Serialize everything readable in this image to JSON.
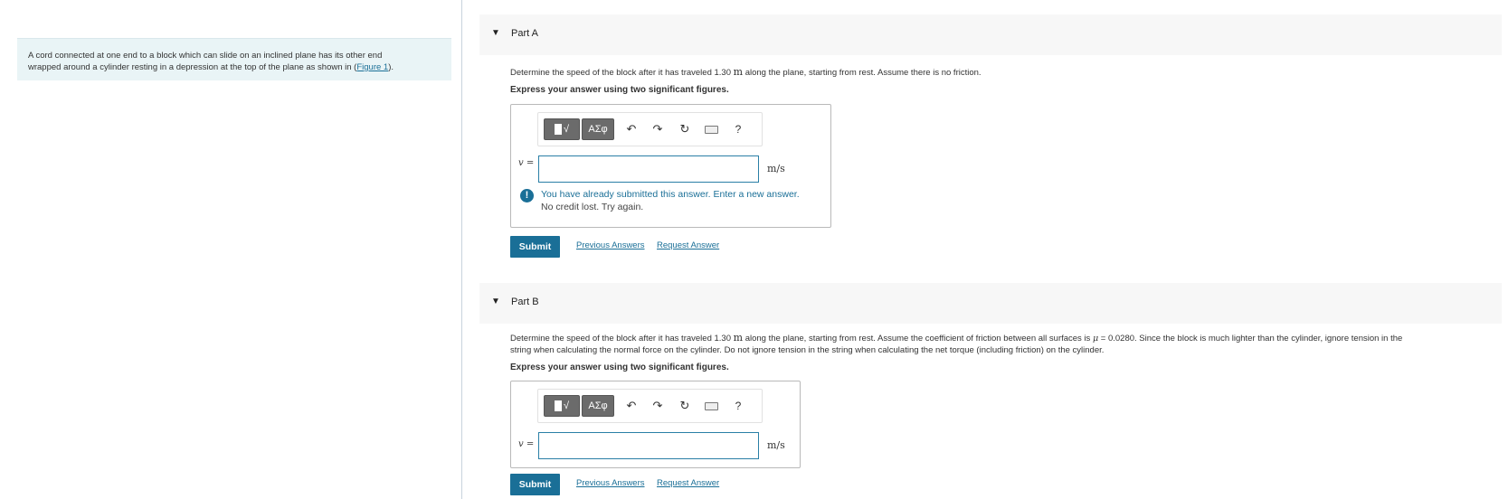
{
  "intro": {
    "line1": "A cord connected at one end to a block which can slide on an inclined plane has its other end",
    "line2_prefix": "wrapped around a cylinder resting in a depression at the top of the plane as shown in (",
    "figure_link": "Figure 1",
    "line2_suffix": ")."
  },
  "parts": [
    {
      "title": "Part A",
      "question_prefix": "Determine the speed of the block after it has traveled 1.30",
      "question_unit": "m",
      "question_suffix": "along the plane, starting from rest. Assume there is no friction.",
      "instruction": "Express your answer using two significant figures.",
      "toolbar": {
        "template_btn": "√",
        "symbols_btn": "ΑΣφ",
        "undo": "↶",
        "redo": "↷",
        "reset": "↻",
        "help": "?"
      },
      "variable": "v =",
      "input_value": "",
      "unit": "m/s",
      "feedback_icon": "!",
      "feedback_main": "You have already submitted this answer. Enter a new answer.",
      "feedback_sub": "No credit lost. Try again.",
      "submit": "Submit",
      "previous_answers": "Previous Answers",
      "request_answer": "Request Answer"
    },
    {
      "title": "Part B",
      "question_line1_prefix": "Determine the speed of the block after it has traveled 1.30",
      "question_unit": "m",
      "question_line1_mid": "along the plane, starting from rest. Assume the coefficient of friction between all surfaces is",
      "mu_symbol": "μ",
      "question_line1_suffix": "= 0.0280. Since the block is much lighter than the cylinder, ignore tension in the",
      "question_line2": "string when calculating the normal force on the cylinder. Do not ignore tension in the string when calculating the net torque (including friction) on the cylinder.",
      "instruction": "Express your answer using two significant figures.",
      "toolbar": {
        "template_btn": "√",
        "symbols_btn": "ΑΣφ",
        "undo": "↶",
        "redo": "↷",
        "reset": "↻",
        "help": "?"
      },
      "variable": "v =",
      "input_value": "",
      "unit": "m/s",
      "submit": "Submit",
      "previous_answers": "Previous Answers",
      "request_answer": "Request Answer"
    }
  ],
  "colors": {
    "accent": "#1a6f97",
    "intro_bg": "#e9f4f6",
    "header_bg": "#f7f7f7"
  }
}
